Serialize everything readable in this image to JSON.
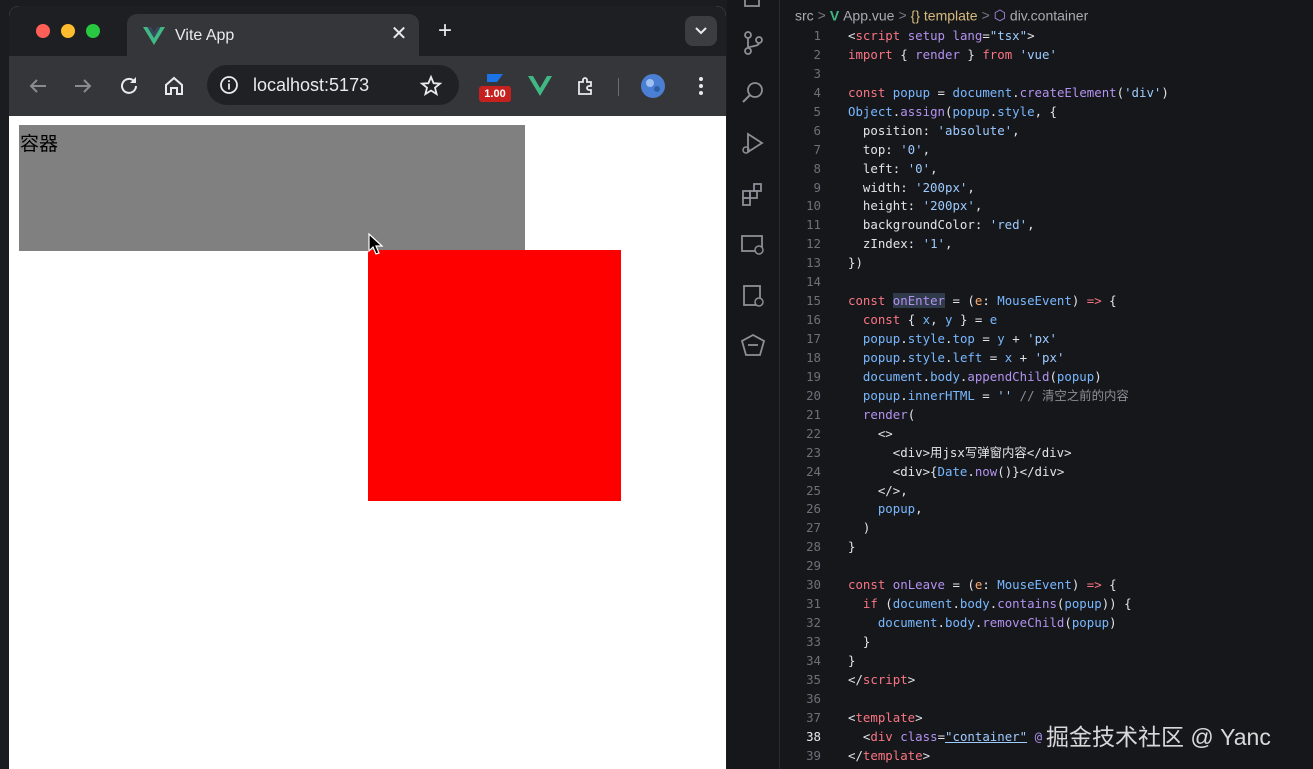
{
  "browser": {
    "tab_title": "Vite App",
    "tab_close": "✕",
    "new_tab": "+",
    "url": "localhost:5173",
    "extension_badge": "1.00"
  },
  "page": {
    "container_label": "容器",
    "container_color": "#808080",
    "popup_color": "#ff0000"
  },
  "editor": {
    "breadcrumb": {
      "folder": "src",
      "file": "App.vue",
      "section": "{} template",
      "element": "div.container"
    },
    "active_line": 38,
    "lines": [
      {
        "n": "1",
        "html": "&lt;<span class='kw'>script</span> <span class='fn'>setup</span> <span class='fn'>lang</span>=<span class='str'>\"tsx\"</span>&gt;"
      },
      {
        "n": "2",
        "html": "<span class='kw'>import</span> { <span class='fn'>render</span> } <span class='kw'>from</span> <span class='str'>'vue'</span>"
      },
      {
        "n": "3",
        "html": ""
      },
      {
        "n": "4",
        "html": "<span class='kw'>const</span> <span class='ty'>popup</span> = <span class='ty'>document</span>.<span class='fn'>createElement</span>(<span class='str'>'div'</span>)"
      },
      {
        "n": "5",
        "html": "<span class='ty'>Object</span>.<span class='fn'>assign</span>(<span class='ty'>popup</span>.<span class='ty'>style</span>, {"
      },
      {
        "n": "6",
        "html": "  position: <span class='str'>'absolute'</span>,"
      },
      {
        "n": "7",
        "html": "  top: <span class='str'>'0'</span>,"
      },
      {
        "n": "8",
        "html": "  left: <span class='str'>'0'</span>,"
      },
      {
        "n": "9",
        "html": "  width: <span class='str'>'200px'</span>,"
      },
      {
        "n": "10",
        "html": "  height: <span class='str'>'200px'</span>,"
      },
      {
        "n": "11",
        "html": "  backgroundColor: <span class='str'>'red'</span>,"
      },
      {
        "n": "12",
        "html": "  zIndex: <span class='str'>'1'</span>,"
      },
      {
        "n": "13",
        "html": "})"
      },
      {
        "n": "14",
        "html": ""
      },
      {
        "n": "15",
        "html": "<span class='kw'>const</span> <span class='fn hl'>onEnter</span> = (<span class='var'>e</span>: <span class='ty'>MouseEvent</span>) <span class='kw'>=&gt;</span> {"
      },
      {
        "n": "16",
        "html": "  <span class='kw'>const</span> { <span class='ty'>x</span>, <span class='ty'>y</span> } = <span class='ty'>e</span>"
      },
      {
        "n": "17",
        "html": "  <span class='ty'>popup</span>.<span class='ty'>style</span>.<span class='ty'>top</span> = <span class='ty'>y</span> + <span class='str'>'px'</span>"
      },
      {
        "n": "18",
        "html": "  <span class='ty'>popup</span>.<span class='ty'>style</span>.<span class='ty'>left</span> = <span class='ty'>x</span> + <span class='str'>'px'</span>"
      },
      {
        "n": "19",
        "html": "  <span class='ty'>document</span>.<span class='ty'>body</span>.<span class='fn'>appendChild</span>(<span class='ty'>popup</span>)"
      },
      {
        "n": "20",
        "html": "  <span class='ty'>popup</span>.<span class='ty'>innerHTML</span> = <span class='str'>''</span> <span class='cm'>// 清空之前的内容</span>"
      },
      {
        "n": "21",
        "html": "  <span class='fn'>render</span>("
      },
      {
        "n": "22",
        "html": "    &lt;&gt;"
      },
      {
        "n": "23",
        "html": "      &lt;div&gt;用jsx写弹窗内容&lt;/div&gt;"
      },
      {
        "n": "24",
        "html": "      &lt;div&gt;{<span class='ty'>Date</span>.<span class='fn'>now</span>()}&lt;/div&gt;"
      },
      {
        "n": "25",
        "html": "    &lt;/&gt;,"
      },
      {
        "n": "26",
        "html": "    <span class='ty'>popup</span>,"
      },
      {
        "n": "27",
        "html": "  )"
      },
      {
        "n": "28",
        "html": "}"
      },
      {
        "n": "29",
        "html": ""
      },
      {
        "n": "30",
        "html": "<span class='kw'>const</span> <span class='fn'>onLeave</span> = (<span class='var'>e</span>: <span class='ty'>MouseEvent</span>) <span class='kw'>=&gt;</span> {"
      },
      {
        "n": "31",
        "html": "  <span class='kw'>if</span> (<span class='ty'>document</span>.<span class='ty'>body</span>.<span class='fn'>contains</span>(<span class='ty'>popup</span>)) {"
      },
      {
        "n": "32",
        "html": "    <span class='ty'>document</span>.<span class='ty'>body</span>.<span class='fn'>removeChild</span>(<span class='ty'>popup</span>)"
      },
      {
        "n": "33",
        "html": "  }"
      },
      {
        "n": "34",
        "html": "}"
      },
      {
        "n": "35",
        "html": "&lt;/<span class='kw'>script</span>&gt;"
      },
      {
        "n": "36",
        "html": ""
      },
      {
        "n": "37",
        "html": "&lt;<span class='kw'>template</span>&gt;"
      },
      {
        "n": "38",
        "html": "  &lt;<span class='kw'>div</span> <span class='fn'>class</span>=<span class='str ul'>\"container\"</span> <span class='fn'>@</span>"
      },
      {
        "n": "39",
        "html": "&lt;/<span class='kw'>template</span>&gt;"
      }
    ]
  },
  "watermark": "掘金技术社区 @ Yanc"
}
